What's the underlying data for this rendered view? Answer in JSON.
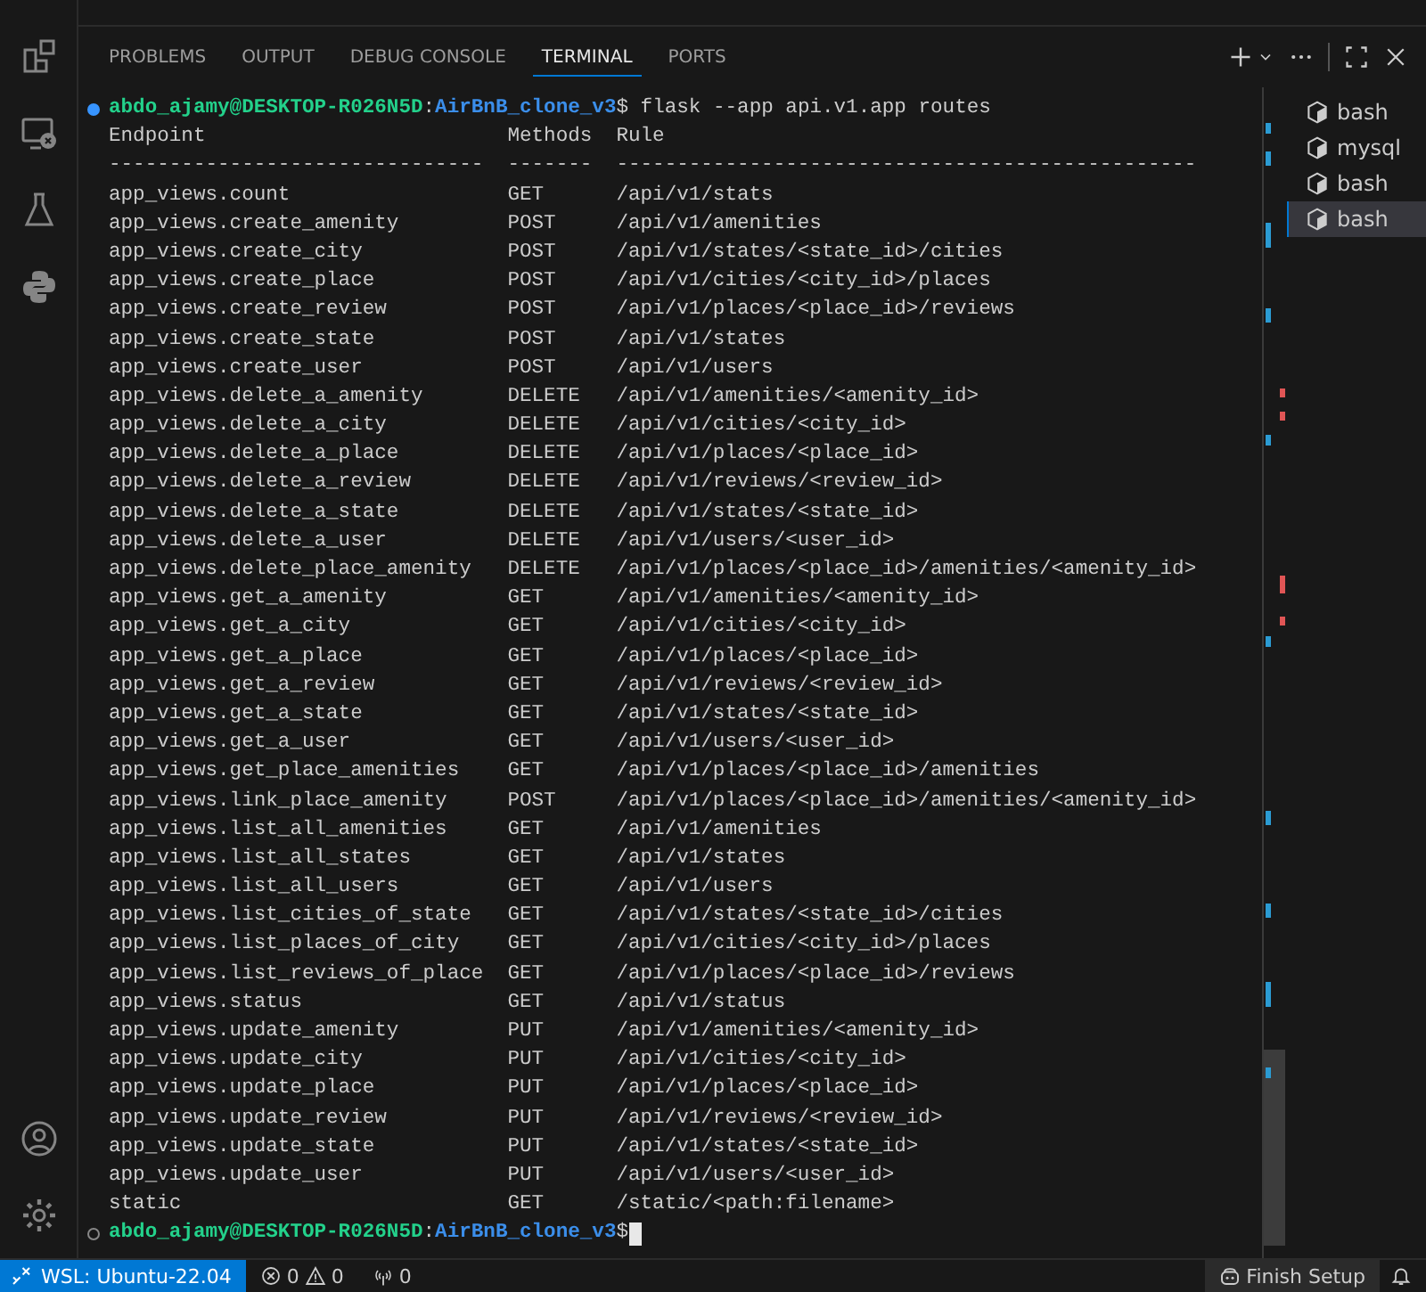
{
  "activity_bar": {
    "top": [
      {
        "kind": "extensions"
      },
      {
        "kind": "remote"
      },
      {
        "kind": "testing"
      },
      {
        "kind": "python"
      }
    ],
    "bottom": [
      {
        "kind": "account"
      },
      {
        "kind": "settings"
      }
    ]
  },
  "panel_tabs": [
    {
      "label": "PROBLEMS",
      "selected": false
    },
    {
      "label": "OUTPUT",
      "selected": false
    },
    {
      "label": "DEBUG CONSOLE",
      "selected": false
    },
    {
      "label": "TERMINAL",
      "selected": true
    },
    {
      "label": "PORTS",
      "selected": false
    }
  ],
  "terminal": {
    "prompt": {
      "kind": "success",
      "user": "abdo_ajamy@DESKTOP-R026N5D",
      "colon": ":",
      "path": "AirBnB_clone_v3",
      "symbol": "$",
      "command": " flask --app api.v1.app routes"
    },
    "header": {
      "endpoint": "Endpoint",
      "methods": "Methods",
      "rule": "Rule"
    },
    "separator": {
      "endpoint": "-------------------------------",
      "methods": "-------",
      "rule": "------------------------------------------------"
    },
    "routes": [
      {
        "endpoint": "app_views.count",
        "method": "GET",
        "rule": "/api/v1/stats"
      },
      {
        "endpoint": "app_views.create_amenity",
        "method": "POST",
        "rule": "/api/v1/amenities"
      },
      {
        "endpoint": "app_views.create_city",
        "method": "POST",
        "rule": "/api/v1/states/<state_id>/cities"
      },
      {
        "endpoint": "app_views.create_place",
        "method": "POST",
        "rule": "/api/v1/cities/<city_id>/places"
      },
      {
        "endpoint": "app_views.create_review",
        "method": "POST",
        "rule": "/api/v1/places/<place_id>/reviews"
      },
      {
        "endpoint": "app_views.create_state",
        "method": "POST",
        "rule": "/api/v1/states"
      },
      {
        "endpoint": "app_views.create_user",
        "method": "POST",
        "rule": "/api/v1/users"
      },
      {
        "endpoint": "app_views.delete_a_amenity",
        "method": "DELETE",
        "rule": "/api/v1/amenities/<amenity_id>"
      },
      {
        "endpoint": "app_views.delete_a_city",
        "method": "DELETE",
        "rule": "/api/v1/cities/<city_id>"
      },
      {
        "endpoint": "app_views.delete_a_place",
        "method": "DELETE",
        "rule": "/api/v1/places/<place_id>"
      },
      {
        "endpoint": "app_views.delete_a_review",
        "method": "DELETE",
        "rule": "/api/v1/reviews/<review_id>"
      },
      {
        "endpoint": "app_views.delete_a_state",
        "method": "DELETE",
        "rule": "/api/v1/states/<state_id>"
      },
      {
        "endpoint": "app_views.delete_a_user",
        "method": "DELETE",
        "rule": "/api/v1/users/<user_id>"
      },
      {
        "endpoint": "app_views.delete_place_amenity",
        "method": "DELETE",
        "rule": "/api/v1/places/<place_id>/amenities/<amenity_id>"
      },
      {
        "endpoint": "app_views.get_a_amenity",
        "method": "GET",
        "rule": "/api/v1/amenities/<amenity_id>"
      },
      {
        "endpoint": "app_views.get_a_city",
        "method": "GET",
        "rule": "/api/v1/cities/<city_id>"
      },
      {
        "endpoint": "app_views.get_a_place",
        "method": "GET",
        "rule": "/api/v1/places/<place_id>"
      },
      {
        "endpoint": "app_views.get_a_review",
        "method": "GET",
        "rule": "/api/v1/reviews/<review_id>"
      },
      {
        "endpoint": "app_views.get_a_state",
        "method": "GET",
        "rule": "/api/v1/states/<state_id>"
      },
      {
        "endpoint": "app_views.get_a_user",
        "method": "GET",
        "rule": "/api/v1/users/<user_id>"
      },
      {
        "endpoint": "app_views.get_place_amenities",
        "method": "GET",
        "rule": "/api/v1/places/<place_id>/amenities"
      },
      {
        "endpoint": "app_views.link_place_amenity",
        "method": "POST",
        "rule": "/api/v1/places/<place_id>/amenities/<amenity_id>"
      },
      {
        "endpoint": "app_views.list_all_amenities",
        "method": "GET",
        "rule": "/api/v1/amenities"
      },
      {
        "endpoint": "app_views.list_all_states",
        "method": "GET",
        "rule": "/api/v1/states"
      },
      {
        "endpoint": "app_views.list_all_users",
        "method": "GET",
        "rule": "/api/v1/users"
      },
      {
        "endpoint": "app_views.list_cities_of_state",
        "method": "GET",
        "rule": "/api/v1/states/<state_id>/cities"
      },
      {
        "endpoint": "app_views.list_places_of_city",
        "method": "GET",
        "rule": "/api/v1/cities/<city_id>/places"
      },
      {
        "endpoint": "app_views.list_reviews_of_place",
        "method": "GET",
        "rule": "/api/v1/places/<place_id>/reviews"
      },
      {
        "endpoint": "app_views.status",
        "method": "GET",
        "rule": "/api/v1/status"
      },
      {
        "endpoint": "app_views.update_amenity",
        "method": "PUT",
        "rule": "/api/v1/amenities/<amenity_id>"
      },
      {
        "endpoint": "app_views.update_city",
        "method": "PUT",
        "rule": "/api/v1/cities/<city_id>"
      },
      {
        "endpoint": "app_views.update_place",
        "method": "PUT",
        "rule": "/api/v1/places/<place_id>"
      },
      {
        "endpoint": "app_views.update_review",
        "method": "PUT",
        "rule": "/api/v1/reviews/<review_id>"
      },
      {
        "endpoint": "app_views.update_state",
        "method": "PUT",
        "rule": "/api/v1/states/<state_id>"
      },
      {
        "endpoint": "app_views.update_user",
        "method": "PUT",
        "rule": "/api/v1/users/<user_id>"
      },
      {
        "endpoint": "static",
        "method": "GET",
        "rule": "/static/<path:filename>"
      }
    ],
    "final_prompt": {
      "kind": "pending",
      "user": "abdo_ajamy@DESKTOP-R026N5D",
      "colon": ":",
      "path": "AirBnB_clone_v3",
      "symbol": "$"
    }
  },
  "terminal_list": [
    {
      "name": "bash",
      "selected": false
    },
    {
      "name": "mysql",
      "selected": false
    },
    {
      "name": "bash",
      "selected": false
    },
    {
      "name": "bash",
      "selected": true
    }
  ],
  "status_bar": {
    "remote": "WSL: Ubuntu-22.04",
    "errors": "0",
    "warnings": "0",
    "ports": "0",
    "finish_setup": "Finish Setup"
  }
}
